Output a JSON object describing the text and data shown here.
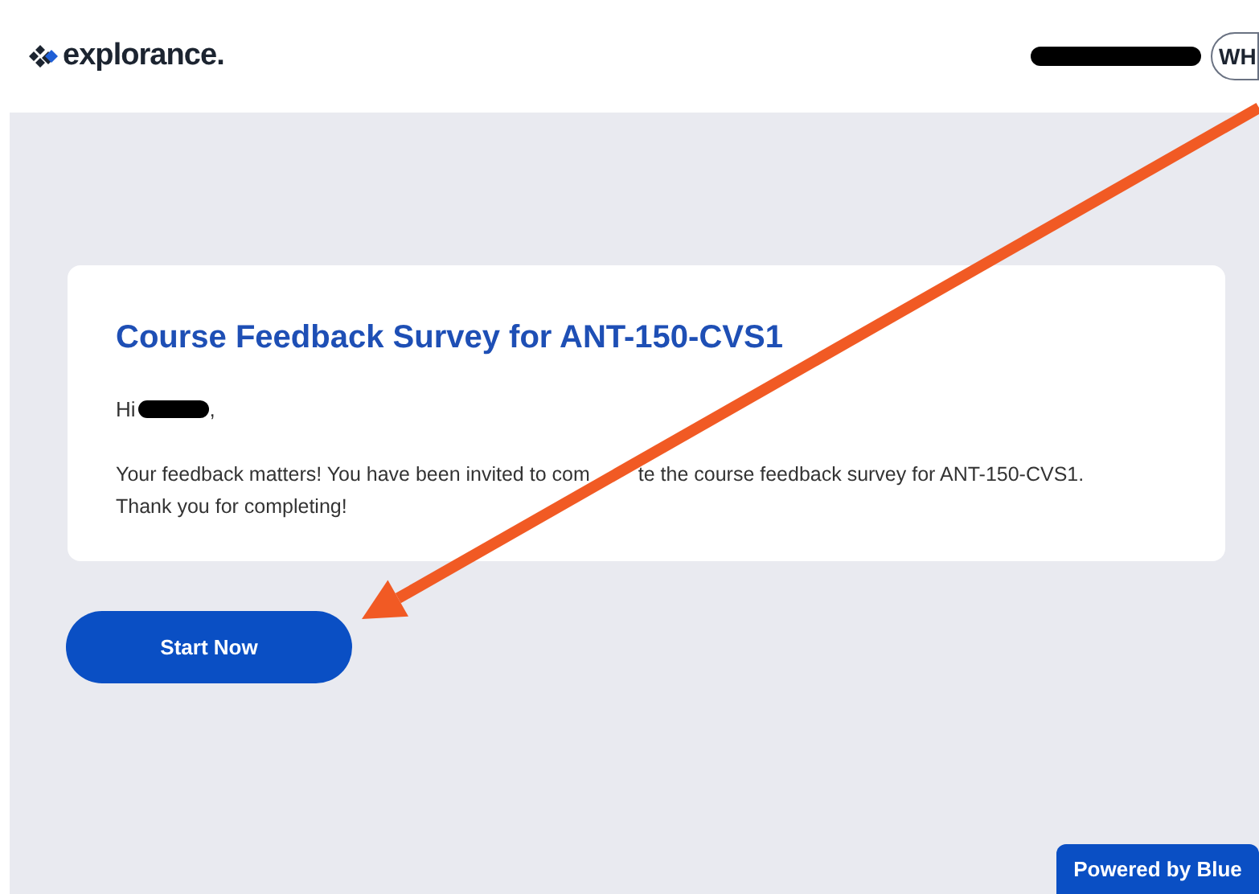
{
  "header": {
    "logo_text": "explorance.",
    "avatar_initials": "WH"
  },
  "card": {
    "title": "Course Feedback Survey for ANT-150-CVS1",
    "greeting": "Hi",
    "greeting_end": ",",
    "message_start": "Your feedback matters! You have been invited to com",
    "message_end": "te the course feedback survey for ANT-150-CVS1.",
    "thanks": "Thank you for completing!"
  },
  "start_button": "Start Now",
  "footer_badge": "Powered by Blue"
}
